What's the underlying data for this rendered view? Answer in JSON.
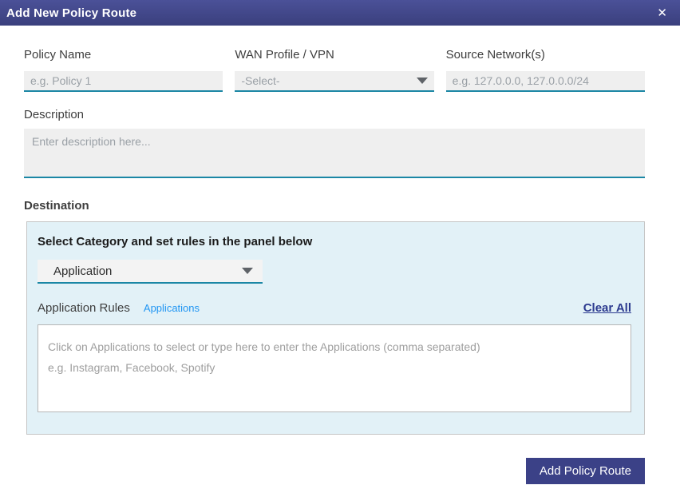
{
  "header": {
    "title": "Add New Policy Route",
    "close_icon": "✕"
  },
  "form": {
    "policy_name": {
      "label": "Policy Name",
      "placeholder": "e.g. Policy 1",
      "value": ""
    },
    "wan_profile": {
      "label": "WAN Profile / VPN",
      "selected": "-Select-"
    },
    "source_networks": {
      "label": "Source Network(s)",
      "placeholder": "e.g. 127.0.0.0, 127.0.0.0/24",
      "value": ""
    },
    "description": {
      "label": "Description",
      "placeholder": "Enter description here...",
      "value": ""
    }
  },
  "destination": {
    "label": "Destination",
    "instruction": "Select Category and set rules in the panel below",
    "category_selected": "Application",
    "rules": {
      "label": "Application Rules",
      "link": "Applications",
      "clear_all": "Clear All",
      "placeholder_line1": "Click on Applications to select or type here to enter the Applications (comma separated)",
      "placeholder_line2": "e.g. Instagram, Facebook, Spotify"
    }
  },
  "actions": {
    "submit": "Add Policy Route"
  },
  "colors": {
    "header_gradient_top": "#4b5198",
    "header_gradient_bottom": "#3a3f7d",
    "accent_underline": "#1b87a5",
    "panel_bg": "#e2f1f7",
    "link_blue": "#2196f3",
    "clear_all_navy": "#2c3a8f",
    "button_bg": "#3b4187"
  }
}
